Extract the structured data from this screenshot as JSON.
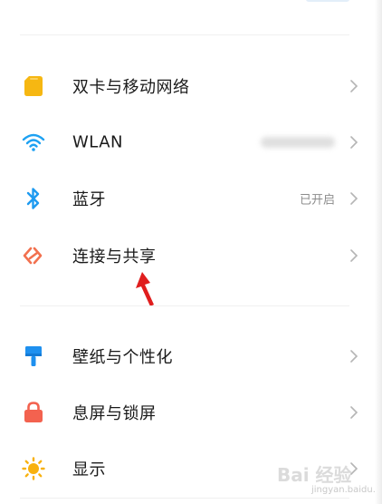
{
  "settings": {
    "items": [
      {
        "label": "双卡与移动网络",
        "value": "",
        "icon": "sim-card-icon"
      },
      {
        "label": "WLAN",
        "value": "",
        "icon": "wifi-icon"
      },
      {
        "label": "蓝牙",
        "value": "已开启",
        "icon": "bluetooth-icon"
      },
      {
        "label": "连接与共享",
        "value": "",
        "icon": "connection-share-icon"
      },
      {
        "label": "壁纸与个性化",
        "value": "",
        "icon": "paint-brush-icon"
      },
      {
        "label": "息屏与锁屏",
        "value": "",
        "icon": "lock-icon"
      },
      {
        "label": "显示",
        "value": "",
        "icon": "sun-icon"
      }
    ]
  },
  "colors": {
    "sim": "#f6b712",
    "wifi": "#1da1f2",
    "bluetooth": "#1e9af0",
    "connection": "#f2714f",
    "brush": "#1e90ef",
    "lock": "#f3624f",
    "sun": "#f8b10e",
    "annotation": "#e01e1e"
  },
  "watermark": {
    "text": "Bai 经验",
    "url": "jingyan.baidu.com"
  }
}
